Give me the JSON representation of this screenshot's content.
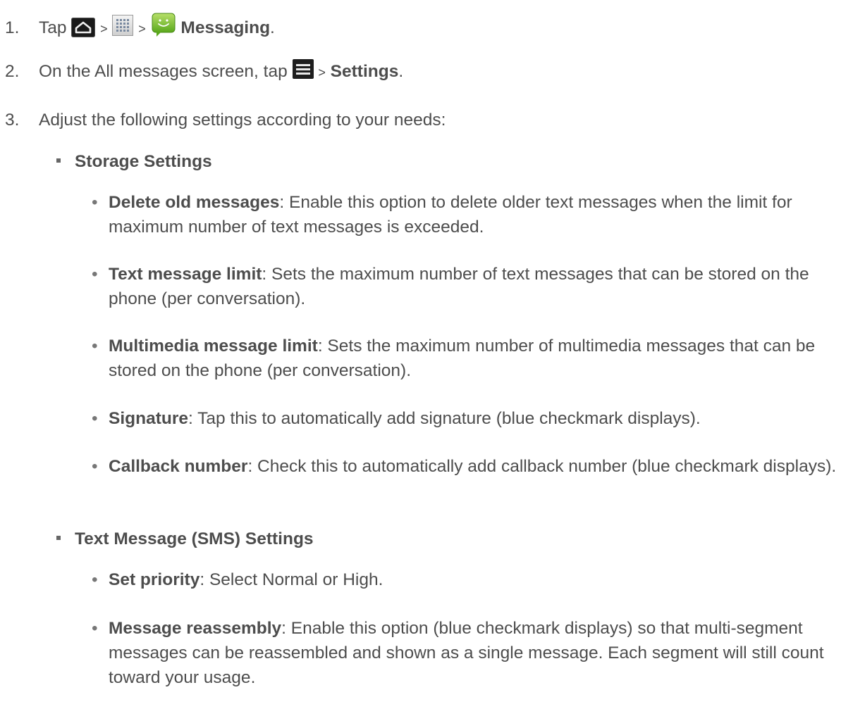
{
  "steps": [
    {
      "num": "1.",
      "pre": "Tap",
      "gt1": ">",
      "gt2": ">",
      "bold": "Messaging",
      "post": "."
    },
    {
      "num": "2.",
      "pre": "On the All messages screen, tap",
      "gt": ">",
      "bold": "Settings",
      "post": "."
    },
    {
      "num": "3.",
      "text": "Adjust the following settings according to your needs:"
    }
  ],
  "icons": {
    "home": "home-icon",
    "apps": "apps-grid-icon",
    "messaging": "messaging-app-icon",
    "menu": "menu-icon"
  },
  "sections": [
    {
      "title": "Storage Settings",
      "items": [
        {
          "term": "Delete old messages",
          "desc": ": Enable this option to delete older text messages when the limit for maximum number of text messages is exceeded."
        },
        {
          "term": "Text message limit",
          "desc": ": Sets the maximum number of text messages that can be stored on the phone (per conversation)."
        },
        {
          "term": "Multimedia message limit",
          "desc": ": Sets the maximum number of multimedia messages that can be stored on the phone (per conversation)."
        },
        {
          "term": "Signature",
          "desc": ": Tap this to automatically add signature (blue checkmark displays)."
        },
        {
          "term": "Callback number",
          "desc": ": Check this to automatically add callback number (blue checkmark displays)."
        }
      ]
    },
    {
      "title": "Text Message (SMS) Settings",
      "items": [
        {
          "term": "Set priority",
          "desc": ": Select Normal or High."
        },
        {
          "term": "Message reassembly",
          "desc": ": Enable this option (blue checkmark displays) so that multi-segment messages can be reassembled and shown as a single message. Each segment will still count toward your usage."
        }
      ]
    }
  ],
  "bullet": "•"
}
